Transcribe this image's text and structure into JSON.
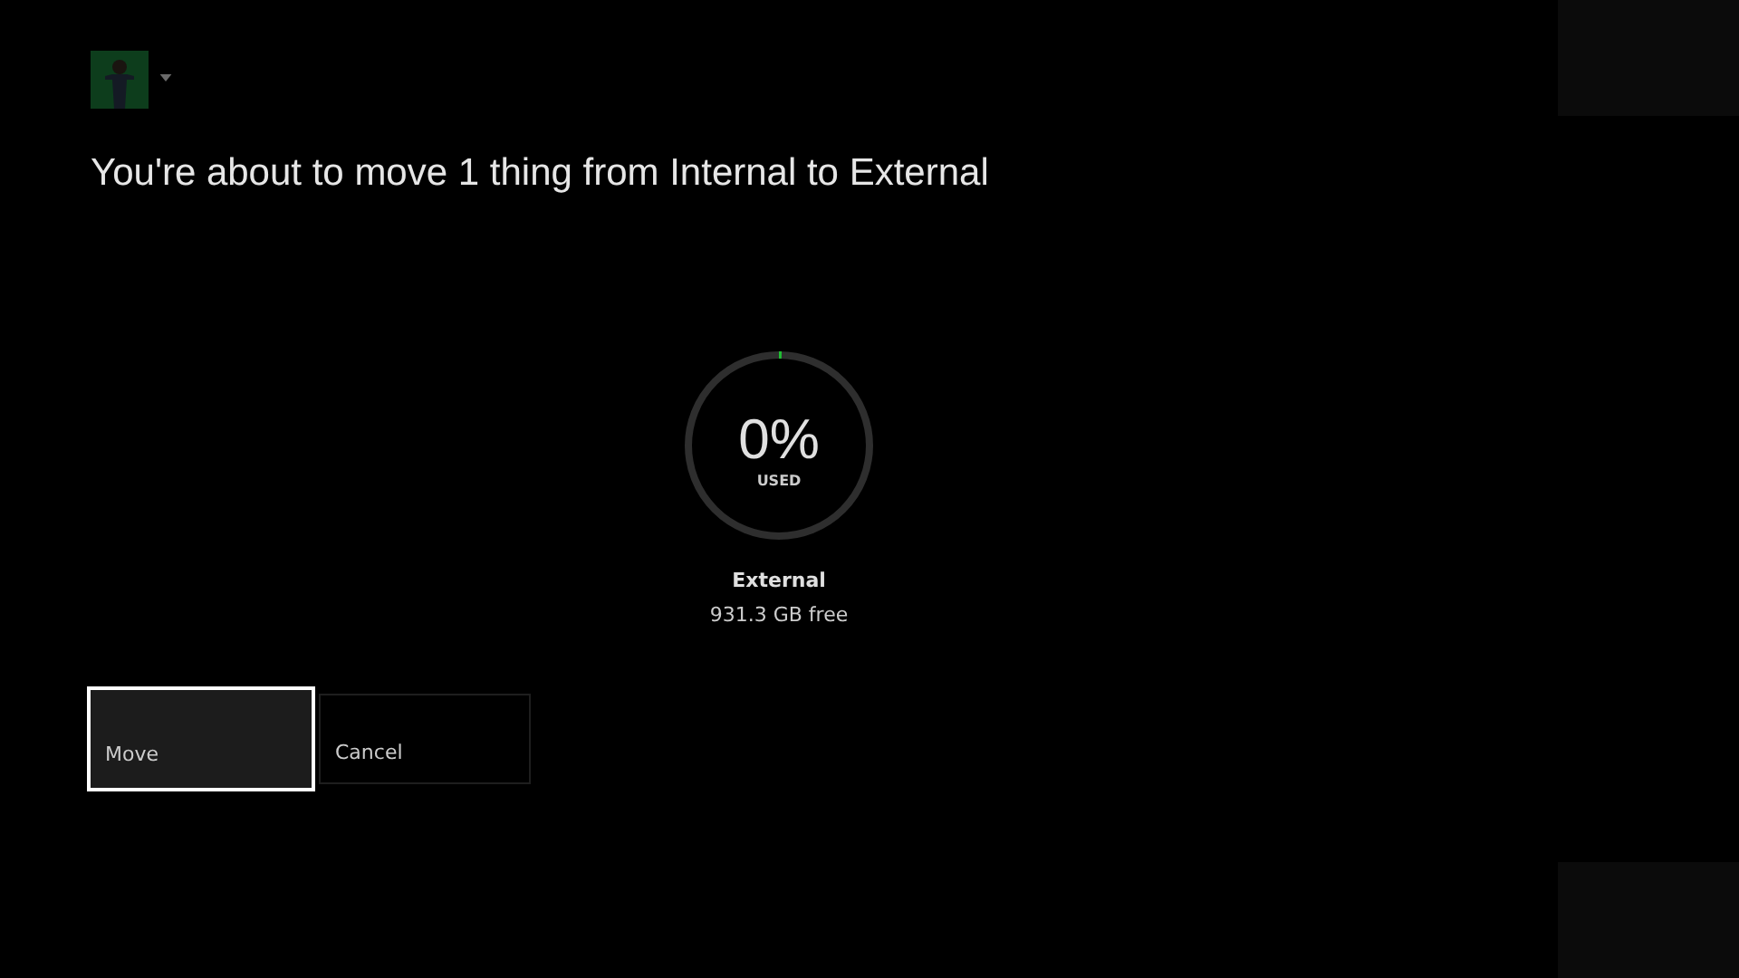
{
  "header": {
    "title": "You're about to move 1 thing from Internal to External"
  },
  "storage": {
    "percent": "0%",
    "unit": "USED",
    "name": "External",
    "free": "931.3 GB free"
  },
  "buttons": [
    {
      "label": "Move",
      "selected": true
    },
    {
      "label": "Cancel",
      "selected": false
    }
  ]
}
